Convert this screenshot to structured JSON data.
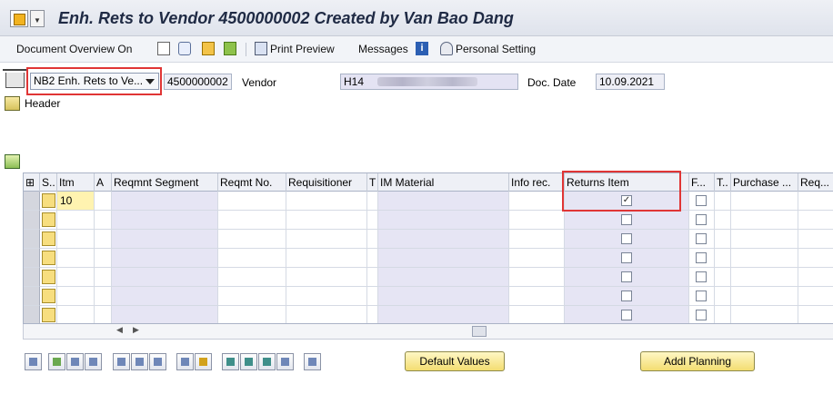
{
  "window": {
    "title": "Enh. Rets to Vendor 4500000002 Created by Van Bao Dang"
  },
  "toolbar": {
    "document_overview": "Document Overview On",
    "print_preview": "Print Preview",
    "messages": "Messages",
    "personal_setting": "Personal Setting"
  },
  "header": {
    "doc_type": "NB2 Enh. Rets to Ve...",
    "doc_number": "4500000002",
    "vendor_label": "Vendor",
    "vendor_value": "H14",
    "doc_date_label": "Doc. Date",
    "doc_date_value": "10.09.2021",
    "header_label": "Header"
  },
  "grid": {
    "columns": [
      {
        "key": "config",
        "label": ""
      },
      {
        "key": "sel",
        "label": ""
      },
      {
        "key": "s",
        "label": "S.."
      },
      {
        "key": "itm",
        "label": "Itm"
      },
      {
        "key": "a",
        "label": "A"
      },
      {
        "key": "reqmnt_segment",
        "label": "Reqmnt Segment"
      },
      {
        "key": "reqmt_no",
        "label": "Reqmt No."
      },
      {
        "key": "requisitioner",
        "label": "Requisitioner"
      },
      {
        "key": "t",
        "label": "T"
      },
      {
        "key": "im_material",
        "label": "IM Material"
      },
      {
        "key": "info_rec",
        "label": "Info rec."
      },
      {
        "key": "returns_item",
        "label": "Returns Item"
      },
      {
        "key": "f",
        "label": "F..."
      },
      {
        "key": "t2",
        "label": "T.."
      },
      {
        "key": "purchase",
        "label": "Purchase ..."
      },
      {
        "key": "req",
        "label": "Req..."
      }
    ],
    "rows": [
      {
        "itm": "10",
        "returns_item": true,
        "f": false
      },
      {
        "itm": "",
        "returns_item": false,
        "f": false
      },
      {
        "itm": "",
        "returns_item": false,
        "f": false
      },
      {
        "itm": "",
        "returns_item": false,
        "f": false
      },
      {
        "itm": "",
        "returns_item": false,
        "f": false
      },
      {
        "itm": "",
        "returns_item": false,
        "f": false
      },
      {
        "itm": "",
        "returns_item": false,
        "f": false
      }
    ]
  },
  "buttons": {
    "default_values": "Default Values",
    "addl_planning": "Addl Planning"
  },
  "colors": {
    "highlight": "#e03535",
    "field_shade": "#e6e5f4",
    "button_yellow": "#f3dd72"
  }
}
